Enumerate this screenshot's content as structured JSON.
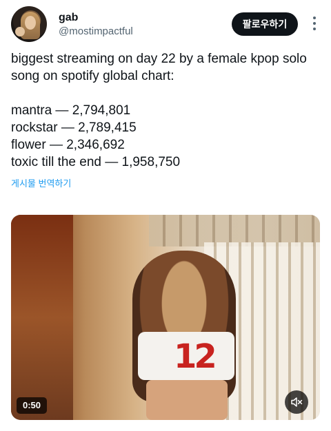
{
  "author": {
    "name": "gab",
    "handle": "@mostimpactful",
    "follow_label": "팔로우하기"
  },
  "tweet": {
    "intro": "biggest streaming on day 22 by a female kpop solo song on spotify global chart:",
    "list": [
      "mantra — 2,794,801",
      "rockstar — 2,789,415",
      "flower — 2,346,692",
      "toxic till the end — 1,958,750"
    ],
    "translate_label": "게시물 번역하기"
  },
  "media": {
    "duration": "0:50",
    "mute_icon": "volume-muted-icon",
    "jersey_number": "12"
  }
}
